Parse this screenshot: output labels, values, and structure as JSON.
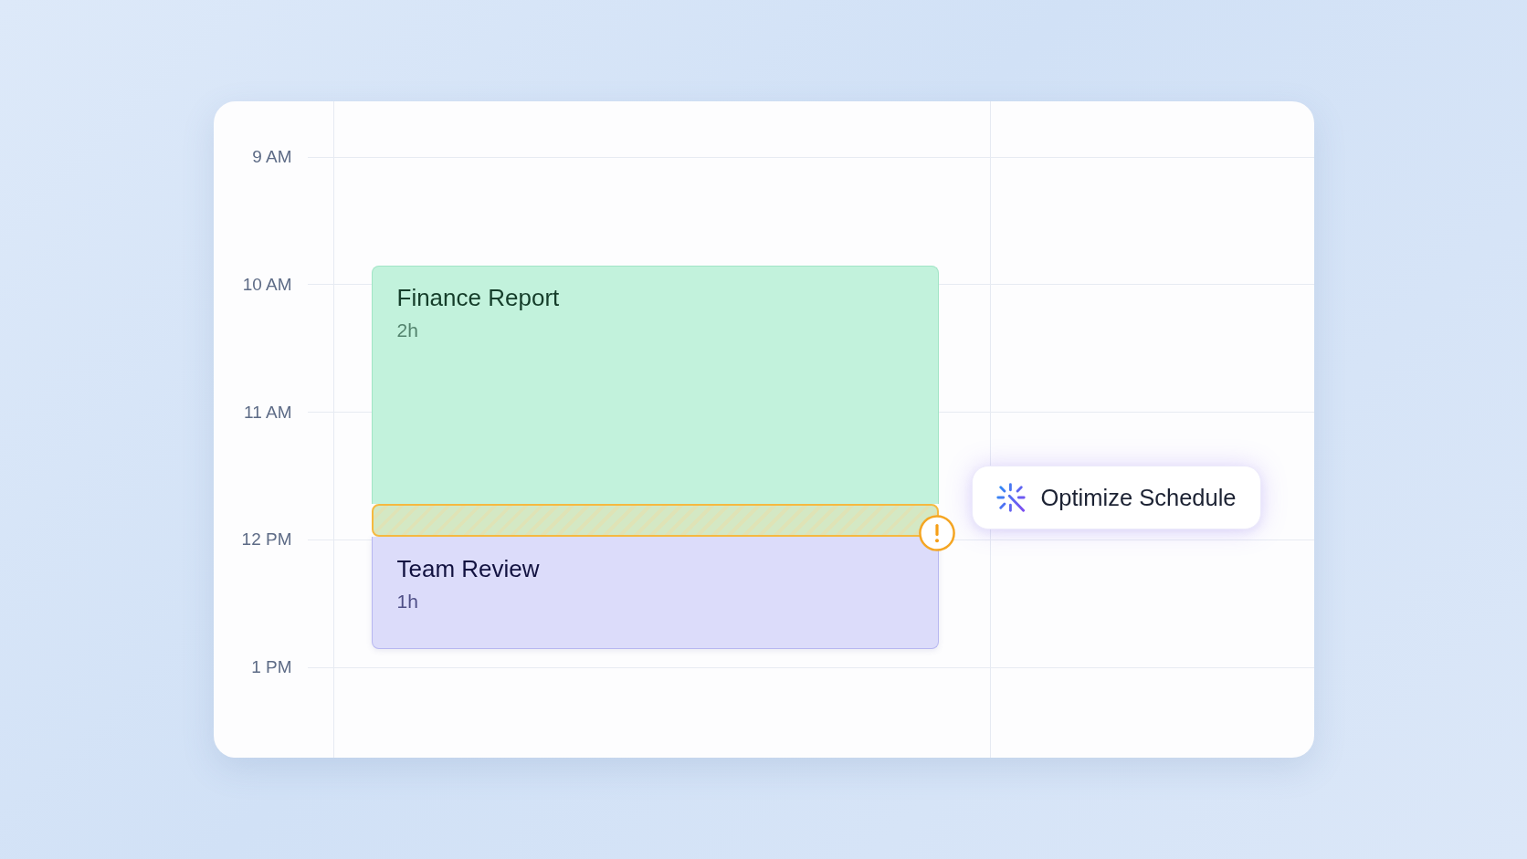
{
  "calendar": {
    "hours": [
      "9 AM",
      "10 AM",
      "11 AM",
      "12 PM",
      "1 PM"
    ],
    "events": [
      {
        "title": "Finance Report",
        "duration": "2h",
        "color": "#c2f2dc"
      },
      {
        "title": "Team Review",
        "duration": "1h",
        "color": "#dcdcfa"
      }
    ],
    "conflict_warning": true
  },
  "action_button": {
    "label": "Optimize Schedule"
  }
}
